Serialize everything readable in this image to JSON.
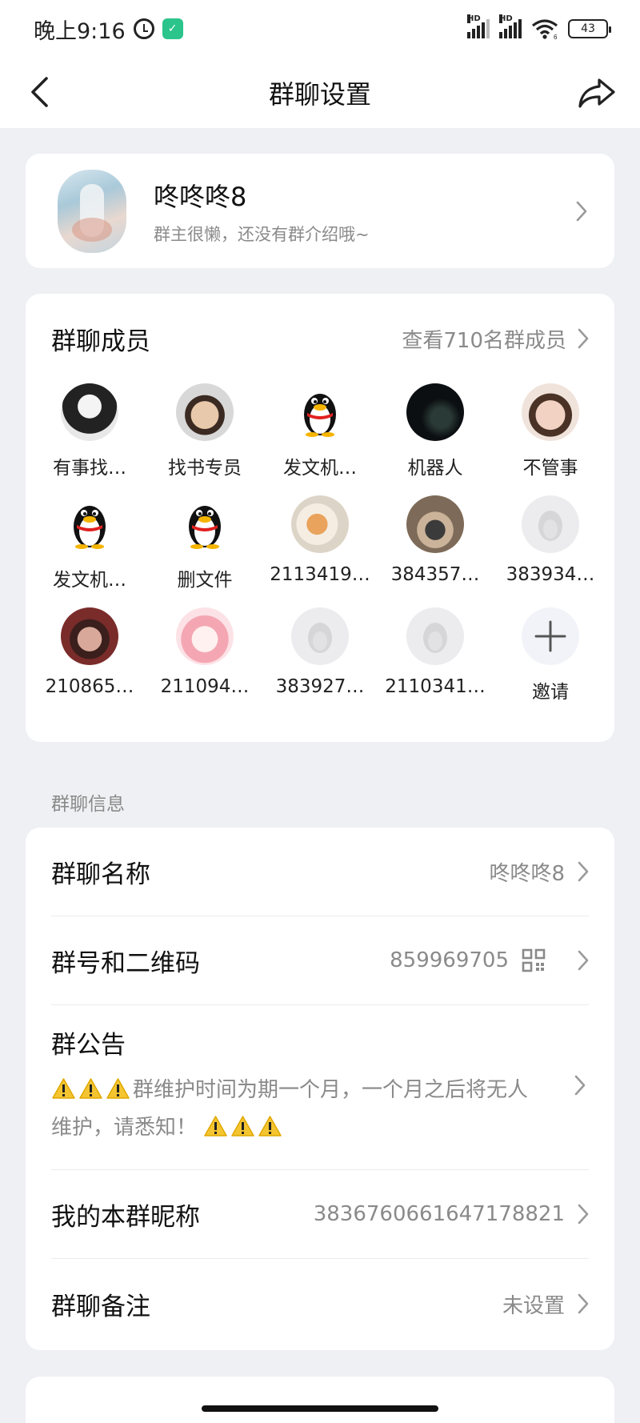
{
  "status_bar": {
    "time": "晚上9:16",
    "battery": "43",
    "signal_label": "HD",
    "wifi_label": "6"
  },
  "nav": {
    "title": "群聊设置"
  },
  "group": {
    "name": "咚咚咚8",
    "description": "群主很懒，还没有群介绍哦~"
  },
  "members": {
    "title": "群聊成员",
    "view_all": "查看710名群成员",
    "items": [
      {
        "name": "有事找…",
        "avatar": "anime-boy"
      },
      {
        "name": "找书专员",
        "avatar": "child-photo"
      },
      {
        "name": "发文机…",
        "avatar": "qq-penguin"
      },
      {
        "name": "机器人",
        "avatar": "night-city"
      },
      {
        "name": "不管事",
        "avatar": "anime-kids"
      },
      {
        "name": "发文机…",
        "avatar": "qq-penguin"
      },
      {
        "name": "删文件",
        "avatar": "qq-penguin"
      },
      {
        "name": "2113419…",
        "avatar": "kitten"
      },
      {
        "name": "384357…",
        "avatar": "child-photo-2"
      },
      {
        "name": "383934…",
        "avatar": "default-penguin"
      },
      {
        "name": "210865…",
        "avatar": "anime-man"
      },
      {
        "name": "211094…",
        "avatar": "anime-girl"
      },
      {
        "name": "383927…",
        "avatar": "default-penguin"
      },
      {
        "name": "2110341…",
        "avatar": "default-penguin"
      },
      {
        "name": "邀请",
        "avatar": "plus-icon"
      }
    ]
  },
  "info": {
    "section_label": "群聊信息",
    "group_name_label": "群聊名称",
    "group_name_value": "咚咚咚8",
    "group_id_label": "群号和二维码",
    "group_id_value": "859969705",
    "notice_label": "群公告",
    "notice_text": "群维护时间为期一个月，一个月之后将无人维护，请悉知！",
    "nickname_label": "我的本群昵称",
    "nickname_value": "3836760661647178821",
    "remark_label": "群聊备注",
    "remark_value": "未设置"
  },
  "colors": {
    "background": "#eff0f3",
    "card": "#ffffff",
    "secondary_text": "#8a8a8a",
    "warning_yellow": "#f4c531"
  }
}
